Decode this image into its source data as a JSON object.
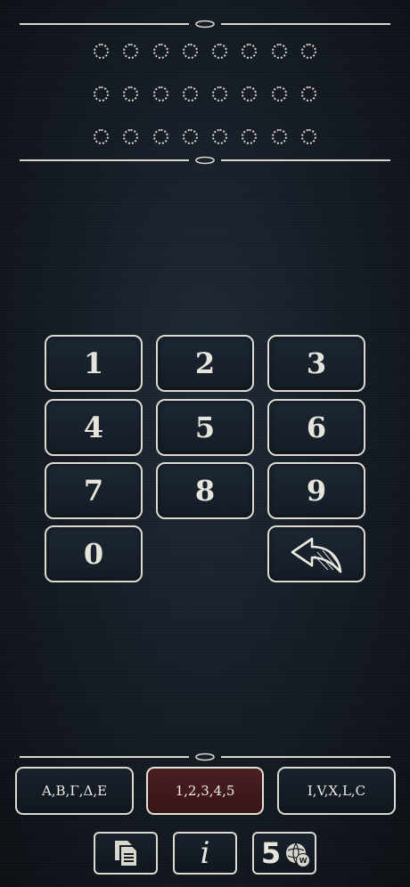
{
  "keypad": {
    "keys": [
      "1",
      "2",
      "3",
      "4",
      "5",
      "6",
      "7",
      "8",
      "9",
      "0"
    ]
  },
  "modes": {
    "greek_label": "Α,Β,Γ,Δ,Ε",
    "arabic_label": "1,2,3,4,5",
    "roman_label": "I,V,X,L,C",
    "selected": "arabic"
  },
  "toolbar": {
    "info_label": "i",
    "number_label": "5",
    "globe_badge": "W"
  },
  "display": {
    "rows": 3,
    "dots_per_row": 8
  },
  "colors": {
    "background": "#151c25",
    "border": "#dcdbd2",
    "active_mode": "#4a1f22"
  }
}
